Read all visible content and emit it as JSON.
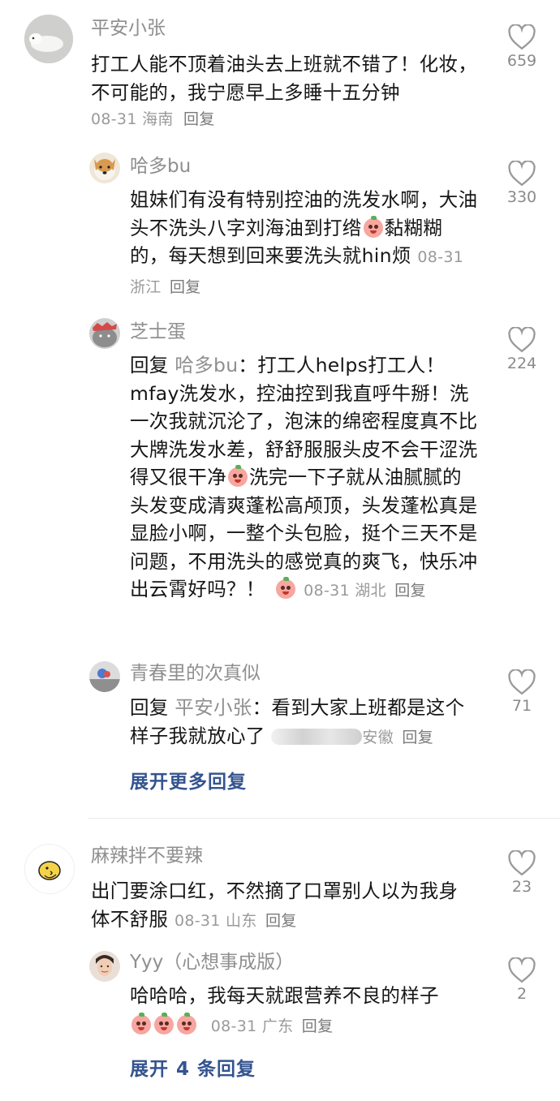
{
  "comments": [
    {
      "name": "平安小张",
      "text": "打工人能不顶着油头去上班就不错了！化妆，不可能的，我宁愿早上多睡十五分钟",
      "date": "08-31",
      "region": "海南",
      "reply": "回复",
      "likes": "659",
      "replies": [
        {
          "name": "哈多bu",
          "text": "姐妹们有没有特别控油的洗发水啊，大油头不洗头八字刘海油到打绺",
          "text2": "黏糊糊的，每天想到回来要洗头就hin烦",
          "date": "08-31",
          "region": "浙江",
          "reply": "回复",
          "likes": "330"
        },
        {
          "name": "芝士蛋",
          "reply_prefix": "回复",
          "reply_to": "哈多bu",
          "text": "：打工人helps打工人！mfay洗发水，控油控到我直呼牛掰！洗一次我就沉沦了，泡沫的绵密程度真不比大牌洗发水差，舒舒服服头皮不会干涩洗得又很干净",
          "text2": "洗完一下子就从油腻腻的头发变成清爽蓬松高颅顶，头发蓬松真是显脸小啊，一整个头包脸，挺个三天不是问题，不用洗头的感觉真的爽飞，快乐冲出云霄好吗？！",
          "date": "08-31",
          "region": "湖北",
          "reply": "回复",
          "likes": "224"
        },
        {
          "name": "青春里的次真似",
          "reply_prefix": "回复",
          "reply_to": "平安小张",
          "text": "：看到大家上班都是这个样子我就放心了",
          "region": "安徽",
          "reply": "回复",
          "likes": "71"
        }
      ],
      "expand": "展开更多回复"
    },
    {
      "name": "麻辣拌不要辣",
      "text": "出门要涂口红，不然摘了口罩别人以为我身体不舒服",
      "date": "08-31",
      "region": "山东",
      "reply": "回复",
      "likes": "23",
      "replies": [
        {
          "name": "Yyy（心想事成版）",
          "text": "哈哈哈，我每天就跟营养不良的样子",
          "date": "08-31",
          "region": "广东",
          "reply": "回复",
          "likes": "2"
        }
      ],
      "expand": "展开 4 条回复"
    }
  ],
  "icons": {
    "like": "heart-outline-icon",
    "emoji": "peach-face-emoji-icon"
  },
  "colors": {
    "link": "#34548f",
    "meta": "#9a9a9a",
    "name": "#8f8f8f"
  }
}
